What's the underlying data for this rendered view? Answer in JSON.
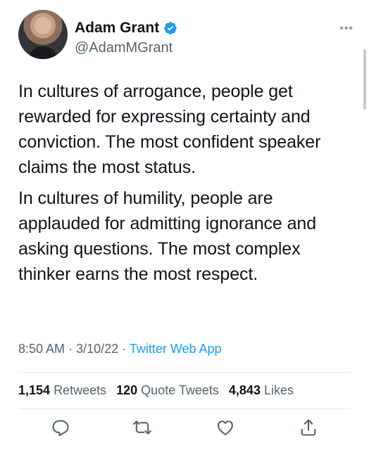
{
  "author": {
    "name": "Adam Grant",
    "handle": "@AdamMGrant",
    "verified": true
  },
  "tweet": {
    "paragraphs": [
      "In cultures of arrogance, people get rewarded for expressing certainty and conviction. The most confident speaker claims the most status.",
      "In cultures of humility, people are applauded for admitting ignorance and asking questions. The most complex thinker earns the most respect."
    ]
  },
  "meta": {
    "time": "8:50 AM",
    "date": "3/10/22",
    "app": "Twitter Web App"
  },
  "stats": {
    "retweets_count": "1,154",
    "retweets_label": "Retweets",
    "quotes_count": "120",
    "quotes_label": "Quote Tweets",
    "likes_count": "4,843",
    "likes_label": "Likes"
  },
  "colors": {
    "accent": "#1d9bf0",
    "secondary_text": "#536471",
    "primary_text": "#0f1419"
  },
  "icons": {
    "reply": "reply-icon",
    "retweet": "retweet-icon",
    "like": "heart-icon",
    "share": "share-icon",
    "more": "more-icon",
    "verified": "verified-badge-icon"
  }
}
